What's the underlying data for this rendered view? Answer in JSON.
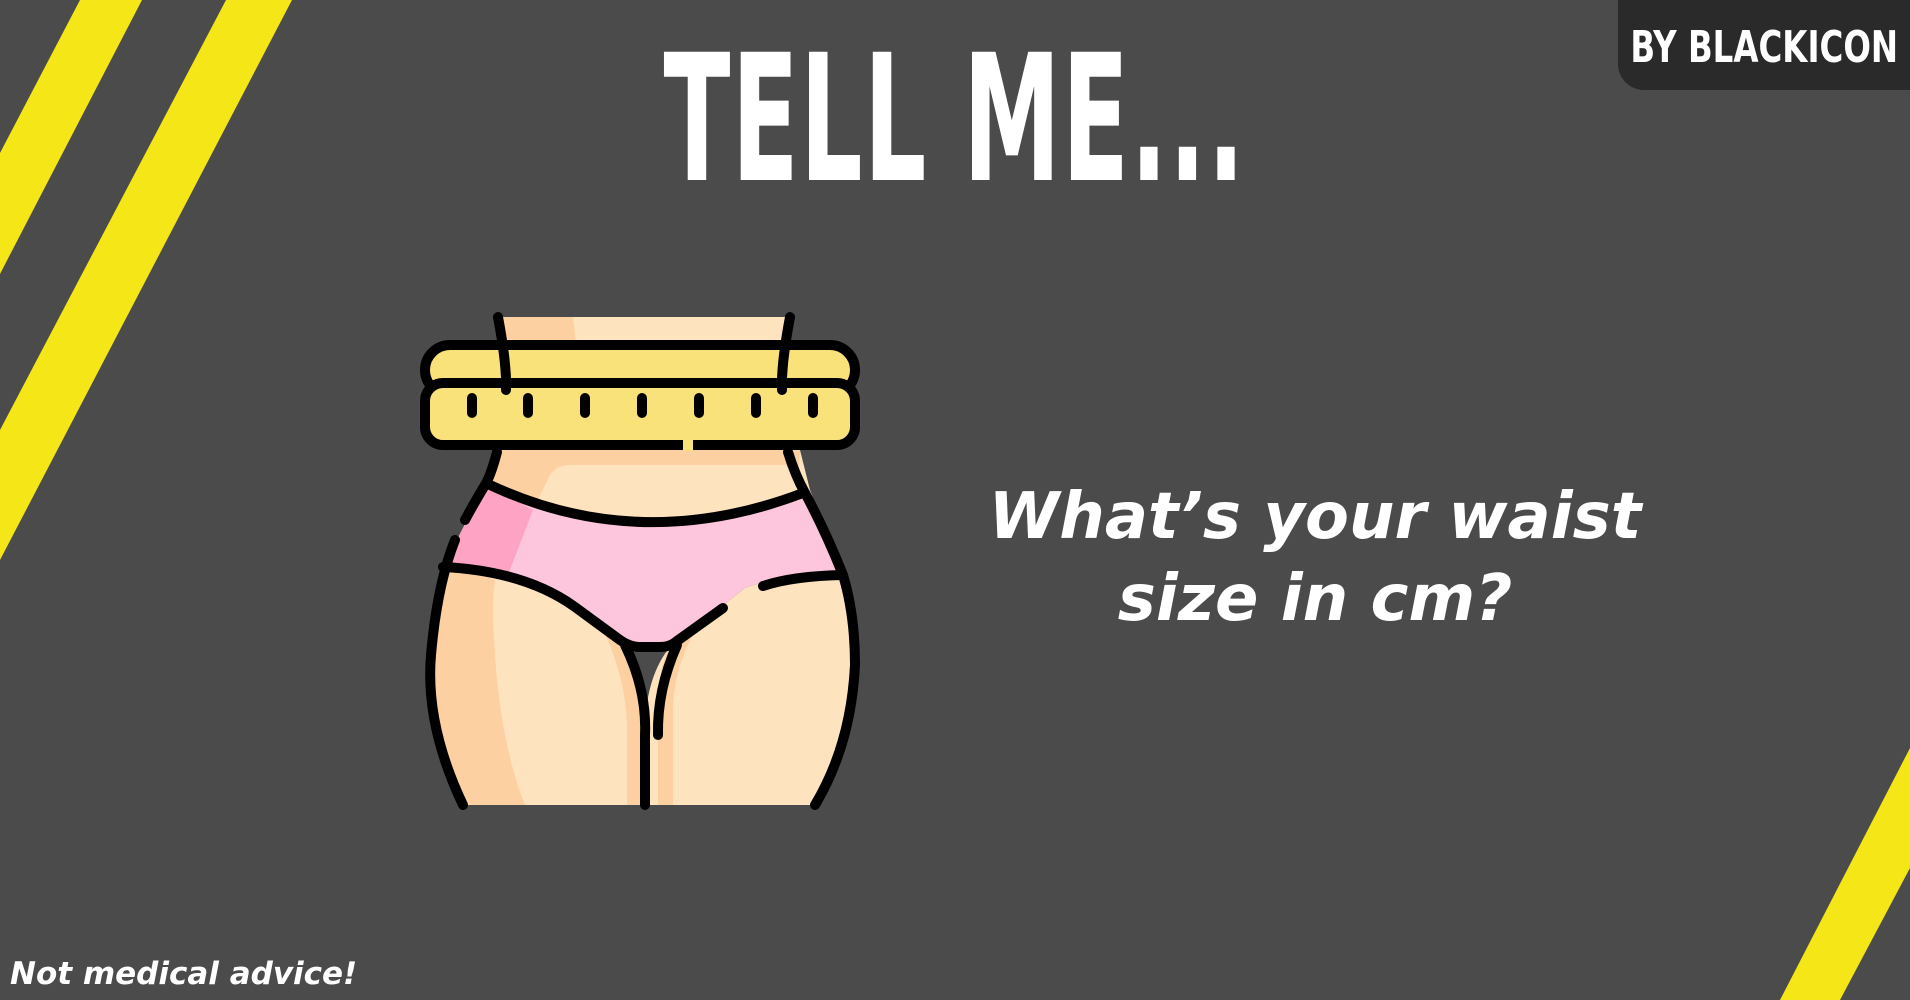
{
  "badge": {
    "text": "BY BLACKICON"
  },
  "title": {
    "text": "TELL ME..."
  },
  "question": {
    "line1": "What’s your waist",
    "line2": "size in cm?"
  },
  "footnote": {
    "text": "Not medical advice!"
  },
  "illustration": {
    "icon": "waist-measurement-icon"
  },
  "colors": {
    "background": "#4b4b4b",
    "stripe": "#f5e617",
    "badge_bg": "#2a2a2a",
    "text": "#ffffff",
    "outline": "#000000",
    "skin_light": "#fee3bf",
    "skin_dark": "#fdd0a1",
    "pink_light": "#fec6dc",
    "pink_dark": "#fea3c4",
    "tape": "#fae27a"
  }
}
